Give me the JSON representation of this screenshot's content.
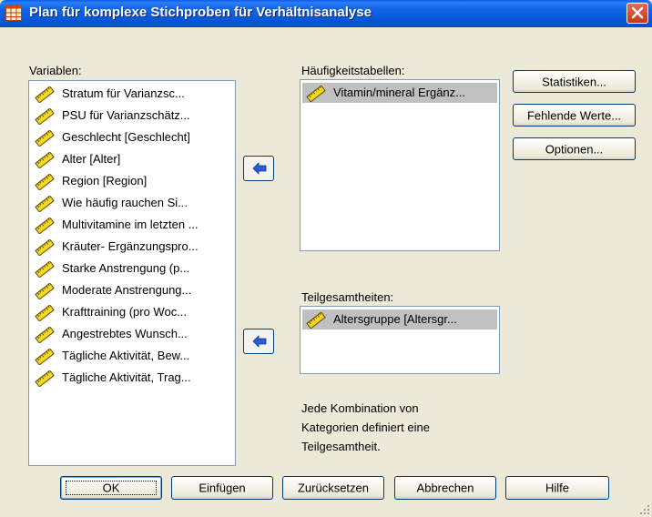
{
  "window": {
    "title": "Plan für komplexe Stichproben für Verhältnisanalyse"
  },
  "variables": {
    "label": "Variablen:",
    "items": [
      "Stratum für Varianzsc...",
      "PSU für Varianzschätz...",
      "Geschlecht [Geschlecht]",
      "Alter [Alter]",
      "Region [Region]",
      "Wie häufig rauchen Si...",
      "Multivitamine im letzten ...",
      "Kräuter- Ergänzungspro...",
      "Starke Anstrengung (p...",
      "Moderate Anstrengung...",
      "Krafttraining (pro Woc...",
      "Angestrebtes Wunsch...",
      "Tägliche Aktivität, Bew...",
      "Tägliche Aktivität, Trag..."
    ]
  },
  "frequency_tables": {
    "label": "Häufigkeitstabellen:",
    "items": [
      "Vitamin/mineral Ergänz..."
    ]
  },
  "subpopulations": {
    "label": "Teilgesamtheiten:",
    "items": [
      "Altersgruppe [Altersgr..."
    ]
  },
  "info_text": "Jede Kombination von\nKategorien definiert eine\nTeilgesamtheit.",
  "side_buttons": {
    "statistics": "Statistiken...",
    "missing_values": "Fehlende Werte...",
    "options": "Optionen..."
  },
  "bottom_buttons": {
    "ok": "OK",
    "paste": "Einfügen",
    "reset": "Zurücksetzen",
    "cancel": "Abbrechen",
    "help": "Hilfe"
  },
  "colors": {
    "titlebar": "#0a5ee8",
    "dialog_bg": "#ece9d8",
    "selection": "#c0c0c0",
    "arrow_blue": "#2a5bd7"
  }
}
